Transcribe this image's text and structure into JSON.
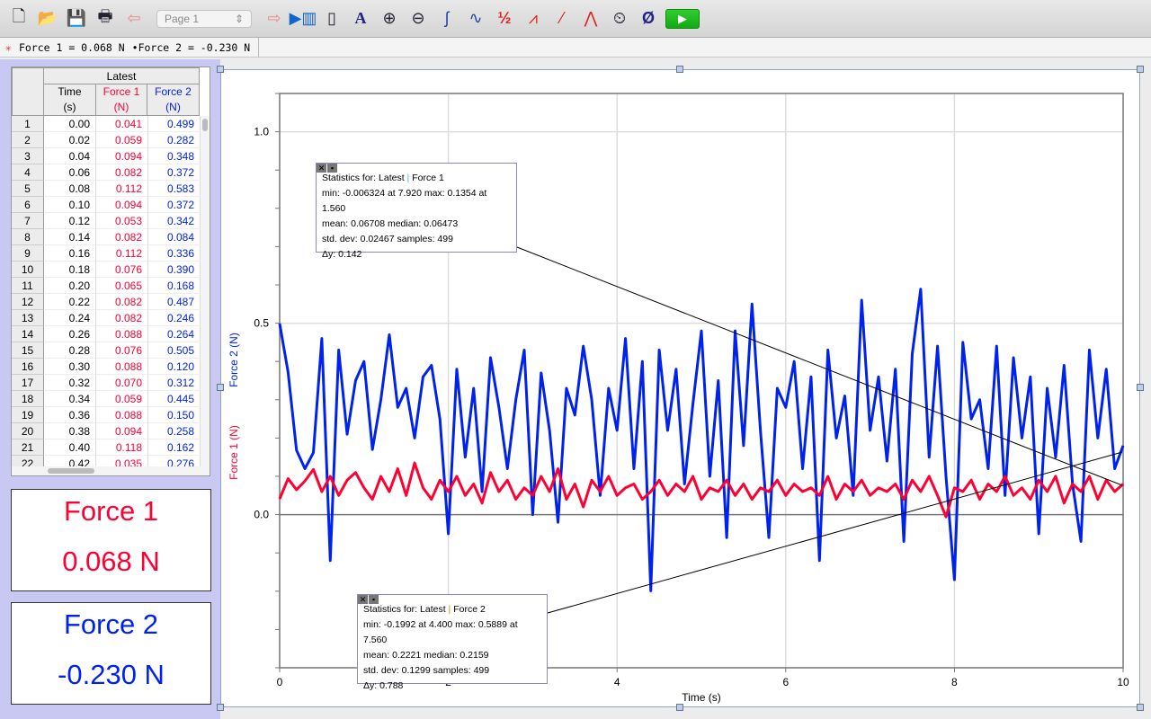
{
  "toolbar": {
    "page_select": "Page 1",
    "icons": [
      "new-file",
      "open-folder",
      "save-disk",
      "print",
      "back-page",
      "next-page",
      "data-browser",
      "lab-interface",
      "autoscale",
      "zoom-in",
      "zoom-out",
      "examine",
      "tangent",
      "integrate",
      "statistics",
      "linear-fit",
      "curve-fit",
      "model",
      "timing",
      "zero",
      "collect"
    ]
  },
  "status": {
    "readout1": "Force 1 = 0.068 N",
    "readout2": "•Force 2 = -0.230 N"
  },
  "table": {
    "dataset": "Latest",
    "columns": [
      {
        "name": "Time",
        "unit": "(s)"
      },
      {
        "name": "Force 1",
        "unit": "(N)"
      },
      {
        "name": "Force 2",
        "unit": "(N)"
      }
    ],
    "rows": [
      [
        "1",
        "0.00",
        "0.041",
        "0.499"
      ],
      [
        "2",
        "0.02",
        "0.059",
        "0.282"
      ],
      [
        "3",
        "0.04",
        "0.094",
        "0.348"
      ],
      [
        "4",
        "0.06",
        "0.082",
        "0.372"
      ],
      [
        "5",
        "0.08",
        "0.112",
        "0.583"
      ],
      [
        "6",
        "0.10",
        "0.094",
        "0.372"
      ],
      [
        "7",
        "0.12",
        "0.053",
        "0.342"
      ],
      [
        "8",
        "0.14",
        "0.082",
        "0.084"
      ],
      [
        "9",
        "0.16",
        "0.112",
        "0.336"
      ],
      [
        "10",
        "0.18",
        "0.076",
        "0.390"
      ],
      [
        "11",
        "0.20",
        "0.065",
        "0.168"
      ],
      [
        "12",
        "0.22",
        "0.082",
        "0.487"
      ],
      [
        "13",
        "0.24",
        "0.082",
        "0.246"
      ],
      [
        "14",
        "0.26",
        "0.088",
        "0.264"
      ],
      [
        "15",
        "0.28",
        "0.076",
        "0.505"
      ],
      [
        "16",
        "0.30",
        "0.088",
        "0.120"
      ],
      [
        "17",
        "0.32",
        "0.070",
        "0.312"
      ],
      [
        "18",
        "0.34",
        "0.059",
        "0.445"
      ],
      [
        "19",
        "0.36",
        "0.088",
        "0.150"
      ],
      [
        "20",
        "0.38",
        "0.094",
        "0.258"
      ],
      [
        "21",
        "0.40",
        "0.118",
        "0.162"
      ],
      [
        "22",
        "0.42",
        "0.035",
        "0.276"
      ]
    ]
  },
  "meters": [
    {
      "label": "Force 1",
      "value": "0.068 N",
      "color": "#ff0033"
    },
    {
      "label": "Force 2",
      "value": "-0.230 N",
      "color": "#0022ee"
    }
  ],
  "stats": [
    {
      "title_a": "Statistics for: Latest",
      "title_b": "Force 1",
      "line1": "min: -0.006324 at 7.920 max: 0.1354 at 1.560",
      "line2": "mean: 0.06708 median: 0.06473",
      "line3": "std. dev: 0.02467 samples: 499",
      "line4": "Δy: 0.142"
    },
    {
      "title_a": "Statistics for: Latest",
      "title_b": "Force 2",
      "line1": "min: -0.1992 at 4.400 max: 0.5889 at 7.560",
      "line2": "mean: 0.2221 median: 0.2159",
      "line3": "std. dev: 0.1299 samples: 499",
      "line4": "Δy: 0.788"
    }
  ],
  "chart_data": {
    "type": "line",
    "xlabel": "Time (s)",
    "ylabels": [
      "Force 1 (N)",
      "Force 2 (N)"
    ],
    "xlim": [
      0,
      10
    ],
    "ylim": [
      -0.4,
      1.1
    ],
    "xticks": [
      "0",
      "2",
      "4",
      "6",
      "8",
      "10"
    ],
    "yticks": [
      "0.0",
      "0.5",
      "1.0"
    ],
    "grid": true,
    "x": [
      0,
      0.1,
      0.2,
      0.3,
      0.4,
      0.5,
      0.6,
      0.7,
      0.8,
      0.9,
      1,
      1.1,
      1.2,
      1.3,
      1.4,
      1.5,
      1.6,
      1.7,
      1.8,
      1.9,
      2,
      2.1,
      2.2,
      2.3,
      2.4,
      2.5,
      2.6,
      2.7,
      2.8,
      2.9,
      3,
      3.1,
      3.2,
      3.3,
      3.4,
      3.5,
      3.6,
      3.7,
      3.8,
      3.9,
      4,
      4.1,
      4.2,
      4.3,
      4.4,
      4.5,
      4.6,
      4.7,
      4.8,
      4.9,
      5,
      5.1,
      5.2,
      5.3,
      5.4,
      5.5,
      5.6,
      5.7,
      5.8,
      5.9,
      6,
      6.1,
      6.2,
      6.3,
      6.4,
      6.5,
      6.6,
      6.7,
      6.8,
      6.9,
      7,
      7.1,
      7.2,
      7.3,
      7.4,
      7.5,
      7.6,
      7.7,
      7.8,
      7.9,
      8,
      8.1,
      8.2,
      8.3,
      8.4,
      8.5,
      8.6,
      8.7,
      8.8,
      8.9,
      9,
      9.1,
      9.2,
      9.3,
      9.4,
      9.5,
      9.6,
      9.7,
      9.8,
      9.9,
      10
    ],
    "series": [
      {
        "name": "Force 1",
        "color": "#ff0033",
        "values": [
          0.041,
          0.094,
          0.065,
          0.088,
          0.118,
          0.06,
          0.1,
          0.05,
          0.09,
          0.11,
          0.07,
          0.04,
          0.1,
          0.06,
          0.12,
          0.05,
          0.135,
          0.07,
          0.04,
          0.09,
          0.06,
          0.1,
          0.05,
          0.08,
          0.03,
          0.11,
          0.06,
          0.09,
          0.04,
          0.07,
          0.05,
          0.1,
          0.06,
          0.12,
          0.04,
          0.08,
          0.02,
          0.09,
          0.06,
          0.1,
          0.05,
          0.07,
          0.08,
          0.04,
          0.06,
          0.09,
          0.05,
          0.08,
          0.06,
          0.1,
          0.04,
          0.07,
          0.06,
          0.09,
          0.05,
          0.08,
          0.04,
          0.07,
          0.06,
          0.09,
          0.05,
          0.08,
          0.06,
          0.07,
          0.05,
          0.1,
          0.04,
          0.08,
          0.06,
          0.09,
          0.05,
          0.07,
          0.06,
          0.08,
          0.04,
          0.09,
          0.06,
          0.1,
          0.05,
          -0.006,
          0.07,
          0.06,
          0.09,
          0.04,
          0.08,
          0.06,
          0.1,
          0.05,
          0.07,
          0.04,
          0.09,
          0.06,
          0.1,
          0.03,
          0.08,
          0.06,
          0.1,
          0.04,
          0.09,
          0.06,
          0.08
        ]
      },
      {
        "name": "Force 2",
        "color": "#0022ee",
        "values": [
          0.499,
          0.372,
          0.168,
          0.12,
          0.162,
          0.46,
          -0.12,
          0.43,
          0.21,
          0.35,
          0.4,
          0.17,
          0.3,
          0.47,
          0.28,
          0.33,
          0.2,
          0.36,
          0.39,
          0.25,
          -0.05,
          0.38,
          0.15,
          0.33,
          0.06,
          0.41,
          0.28,
          0.12,
          0.3,
          0.43,
          0.0,
          0.37,
          0.22,
          -0.02,
          0.33,
          0.26,
          0.44,
          0.3,
          0.05,
          0.33,
          0.22,
          0.46,
          0.12,
          0.4,
          -0.199,
          0.43,
          0.22,
          0.38,
          0.08,
          0.29,
          0.48,
          0.1,
          0.35,
          -0.06,
          0.48,
          0.18,
          0.55,
          0.22,
          -0.06,
          0.33,
          0.28,
          0.4,
          0.12,
          0.36,
          -0.12,
          0.43,
          0.2,
          0.31,
          0.05,
          0.56,
          0.22,
          0.36,
          0.14,
          0.38,
          -0.07,
          0.42,
          0.589,
          0.15,
          0.44,
          0.1,
          -0.17,
          0.45,
          0.25,
          0.3,
          0.12,
          0.44,
          0.05,
          0.41,
          0.2,
          0.36,
          -0.05,
          0.33,
          0.15,
          0.39,
          0.08,
          -0.07,
          0.43,
          0.2,
          0.38,
          0.12,
          0.18
        ]
      }
    ]
  }
}
